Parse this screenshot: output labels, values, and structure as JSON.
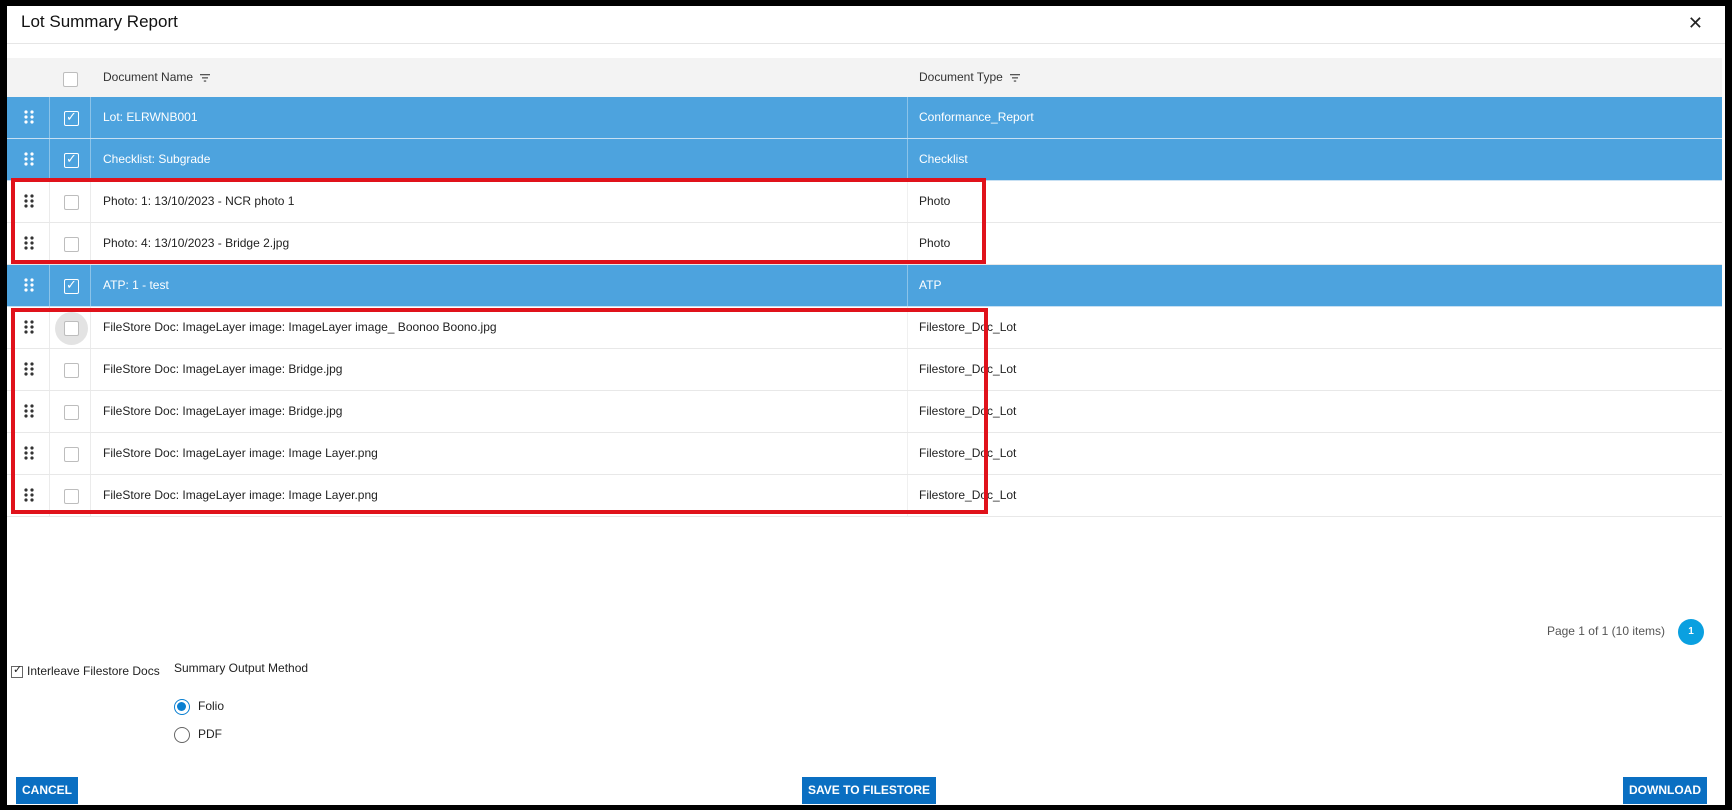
{
  "dialog": {
    "title": "Lot Summary Report",
    "close_label": "✕"
  },
  "grid": {
    "columns": {
      "name": "Document Name",
      "type": "Document Type"
    },
    "rows": [
      {
        "name": "Lot: ELRWNB001",
        "type": "Conformance_Report",
        "checked": true
      },
      {
        "name": "Checklist: Subgrade",
        "type": "Checklist",
        "checked": true
      },
      {
        "name": "Photo: 1: 13/10/2023 - NCR photo 1",
        "type": "Photo",
        "checked": false
      },
      {
        "name": "Photo: 4: 13/10/2023 - Bridge 2.jpg",
        "type": "Photo",
        "checked": false
      },
      {
        "name": "ATP: 1 - test",
        "type": "ATP",
        "checked": true
      },
      {
        "name": "FileStore Doc: ImageLayer image: ImageLayer image_ Boonoo Boono.jpg",
        "type": "Filestore_Doc_Lot",
        "checked": false
      },
      {
        "name": "FileStore Doc: ImageLayer image: Bridge.jpg",
        "type": "Filestore_Doc_Lot",
        "checked": false
      },
      {
        "name": "FileStore Doc: ImageLayer image: Bridge.jpg",
        "type": "Filestore_Doc_Lot",
        "checked": false
      },
      {
        "name": "FileStore Doc: ImageLayer image: Image Layer.png",
        "type": "Filestore_Doc_Lot",
        "checked": false
      },
      {
        "name": "FileStore Doc: ImageLayer image: Image Layer.png",
        "type": "Filestore_Doc_Lot",
        "checked": false
      }
    ]
  },
  "pager": {
    "summary": "Page 1 of 1 (10 items)",
    "current_page": "1"
  },
  "options": {
    "interleave_label": "Interleave Filestore Docs",
    "interleave_checked": true,
    "method_label": "Summary Output Method",
    "methods": [
      {
        "label": "Folio",
        "selected": true
      },
      {
        "label": "PDF",
        "selected": false
      }
    ]
  },
  "buttons": {
    "cancel": "CANCEL",
    "save": "SAVE TO FILESTORE",
    "download": "DOWNLOAD"
  },
  "colors": {
    "selected_row": "#4da3de",
    "highlight": "#e0121b",
    "primary_button": "#0a6fc2",
    "page_badge": "#0aa0e0"
  }
}
